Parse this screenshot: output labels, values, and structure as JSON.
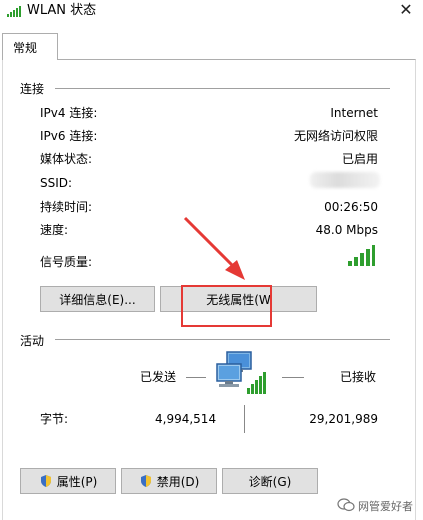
{
  "window": {
    "title": "WLAN 状态",
    "close_glyph": "✕"
  },
  "tabs": [
    {
      "label": "常规"
    }
  ],
  "connection": {
    "group_label": "连接",
    "rows": [
      {
        "label": "IPv4 连接:",
        "value": "Internet"
      },
      {
        "label": "IPv6 连接:",
        "value": "无网络访问权限"
      },
      {
        "label": "媒体状态:",
        "value": "已启用"
      },
      {
        "label": "SSID:",
        "value": ""
      },
      {
        "label": "持续时间:",
        "value": "00:26:50"
      },
      {
        "label": "速度:",
        "value": "48.0 Mbps"
      },
      {
        "label": "信号质量:",
        "value": ""
      }
    ],
    "signal_level": 5,
    "signal_max": 5,
    "details_button": "详细信息(E)...",
    "wireless_props_button": "无线属性(W"
  },
  "activity": {
    "group_label": "活动",
    "sent_label": "已发送",
    "received_label": "已接收",
    "bytes_label": "字节:",
    "bytes_sent": "4,994,514",
    "bytes_received": "29,201,989"
  },
  "bottom_buttons": {
    "properties": "属性(P)",
    "disable": "禁用(D)",
    "diagnose": "诊断(G)"
  },
  "watermark": {
    "text": "网管爱好者"
  },
  "colors": {
    "annotation_red": "#e53935",
    "signal_green": "#2e9e2e",
    "button_bg": "#e1e1e1"
  },
  "icons": [
    "wifi-signal-icon",
    "close-icon",
    "network-computers-icon",
    "shield-icon",
    "wechat-icon"
  ]
}
